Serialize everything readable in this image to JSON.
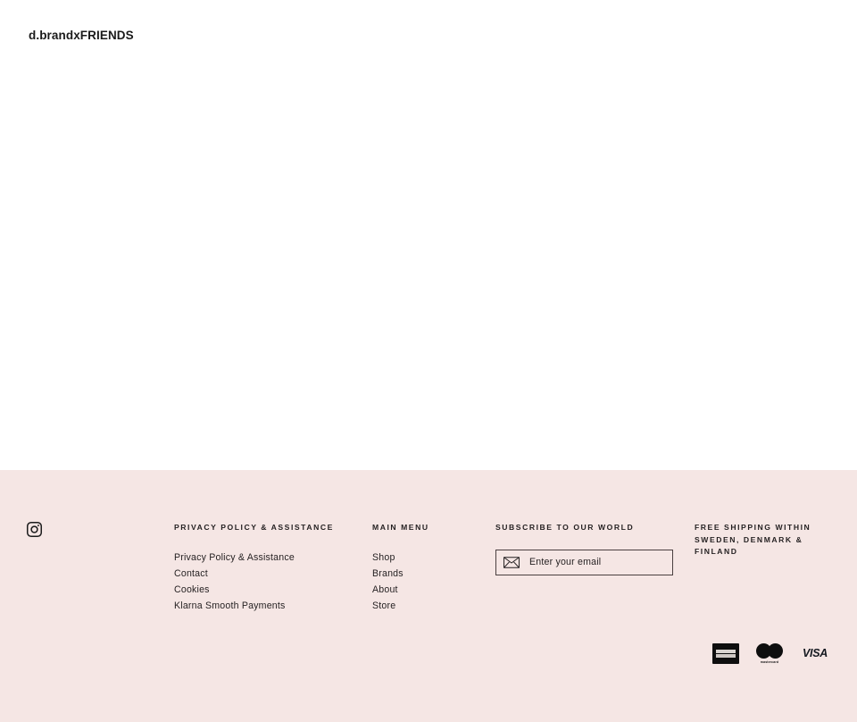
{
  "header": {
    "brand_title": "d.brandxFRIENDS"
  },
  "footer": {
    "background_color": "#f5e6e4",
    "text_color": "#231f20",
    "social": {
      "instagram_label": "Instagram",
      "icon": "instagram-icon"
    },
    "columns": {
      "privacy": {
        "heading": "PRIVACY POLICY & ASSISTANCE",
        "links": [
          "Privacy Policy & Assistance",
          "Contact",
          "Cookies",
          "Klarna Smooth Payments"
        ]
      },
      "main_menu": {
        "heading": "MAIN MENU",
        "links": [
          "Shop",
          "Brands",
          "About",
          "Store"
        ]
      },
      "subscribe": {
        "heading": "SUBSCRIBE TO OUR WORLD",
        "email_placeholder": "Enter your email",
        "email_value": "",
        "icon": "envelope-icon"
      },
      "shipping": {
        "heading": "FREE SHIPPING WITHIN SWEDEN, DENMARK & FINLAND"
      }
    },
    "payments": [
      {
        "name": "american-express",
        "label": "AMERICAN EXPRESS"
      },
      {
        "name": "mastercard",
        "label": "mastercard"
      },
      {
        "name": "visa",
        "label": "VISA"
      }
    ]
  }
}
